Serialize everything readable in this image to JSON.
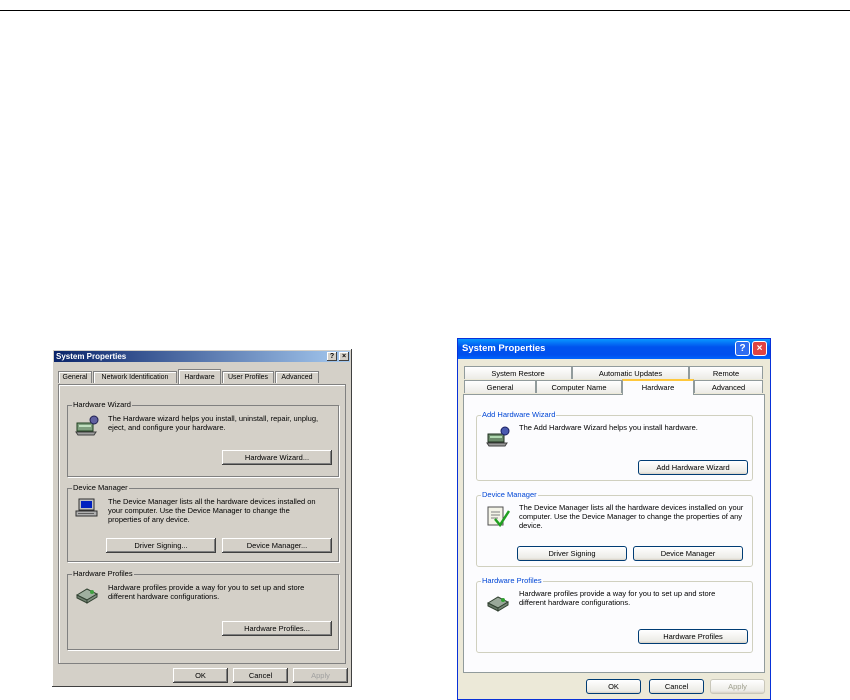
{
  "win2000": {
    "title": "System Properties",
    "help_glyph": "?",
    "close_glyph": "×",
    "tabs": [
      "General",
      "Network Identification",
      "Hardware",
      "User Profiles",
      "Advanced"
    ],
    "active_tab": "Hardware",
    "groups": {
      "wizard": {
        "label": "Hardware Wizard",
        "text": "The Hardware wizard helps you install, uninstall, repair, unplug, eject, and configure your hardware.",
        "button": "Hardware Wizard..."
      },
      "device_manager": {
        "label": "Device Manager",
        "text": "The Device Manager lists all the hardware devices installed on your computer. Use the Device Manager to change the properties of any device.",
        "button_signing": "Driver Signing...",
        "button_manager": "Device Manager..."
      },
      "profiles": {
        "label": "Hardware Profiles",
        "text": "Hardware profiles provide a way for you to set up and store different hardware configurations.",
        "button": "Hardware Profiles..."
      }
    },
    "buttons": {
      "ok": "OK",
      "cancel": "Cancel",
      "apply": "Apply"
    }
  },
  "winxp": {
    "title": "System Properties",
    "help_glyph": "?",
    "close_glyph": "×",
    "tabs_back": [
      "System Restore",
      "Automatic Updates",
      "Remote"
    ],
    "tabs_front": [
      "General",
      "Computer Name",
      "Hardware",
      "Advanced"
    ],
    "active_tab": "Hardware",
    "groups": {
      "wizard": {
        "label": "Add Hardware Wizard",
        "text": "The Add Hardware Wizard helps you install hardware.",
        "button": "Add Hardware Wizard"
      },
      "device_manager": {
        "label": "Device Manager",
        "text": "The Device Manager lists all the hardware devices installed on your computer. Use the Device Manager to change the properties of any device.",
        "button_signing": "Driver Signing",
        "button_manager": "Device Manager"
      },
      "profiles": {
        "label": "Hardware Profiles",
        "text": "Hardware profiles provide a way for you to set up and store different hardware configurations.",
        "button": "Hardware Profiles"
      }
    },
    "buttons": {
      "ok": "OK",
      "cancel": "Cancel",
      "apply": "Apply"
    }
  },
  "colors": {
    "w2k_title_start": "#0a246a",
    "w2k_title_end": "#a6caf0",
    "xp_title": "#0053ee",
    "xp_close": "#e04343",
    "xp_group_label": "#0046d5",
    "xp_tab_highlight": "#ffc83c"
  },
  "icons": [
    "hardware-wizard-icon",
    "device-manager-icon",
    "hardware-profiles-icon",
    "help-icon",
    "close-icon"
  ]
}
